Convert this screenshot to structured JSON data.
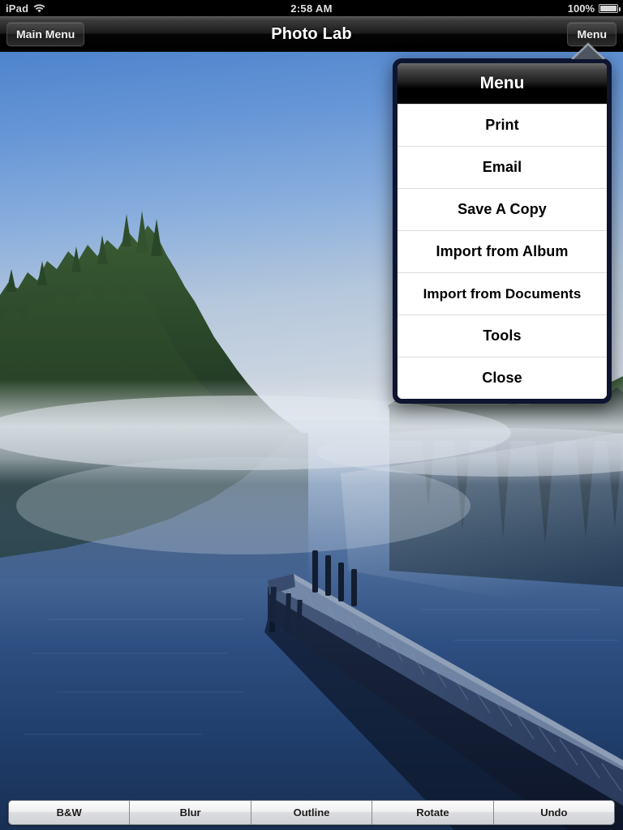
{
  "status_bar": {
    "carrier": "iPad",
    "wifi_icon": "wifi-icon",
    "time": "2:58 AM",
    "battery_percent": "100%",
    "battery_icon": "battery-full-icon"
  },
  "nav_bar": {
    "back_label": "Main Menu",
    "title": "Photo Lab",
    "menu_label": "Menu"
  },
  "popover": {
    "title": "Menu",
    "items": [
      {
        "label": "Print"
      },
      {
        "label": "Email"
      },
      {
        "label": "Save A Copy"
      },
      {
        "label": "Import from Album"
      },
      {
        "label": "Import from Documents"
      },
      {
        "label": "Tools"
      },
      {
        "label": "Close"
      }
    ]
  },
  "toolbar": {
    "segments": [
      {
        "label": "B&W"
      },
      {
        "label": "Blur"
      },
      {
        "label": "Outline"
      },
      {
        "label": "Rotate"
      },
      {
        "label": "Undo"
      }
    ]
  },
  "photo": {
    "description": "Misty lake at dawn with a wooden dock extending into calm water, forested shorelines reflected on the surface",
    "colors": {
      "sky_top": "#5b8ed0",
      "sky_bottom": "#cdd7e2",
      "water_deep": "#1d3c6b",
      "water_light": "#91a9c6",
      "trees_left": "#2c4a2a",
      "trees_right": "#192a22",
      "dock": "#24334d",
      "mist": "#d7dde6"
    }
  }
}
